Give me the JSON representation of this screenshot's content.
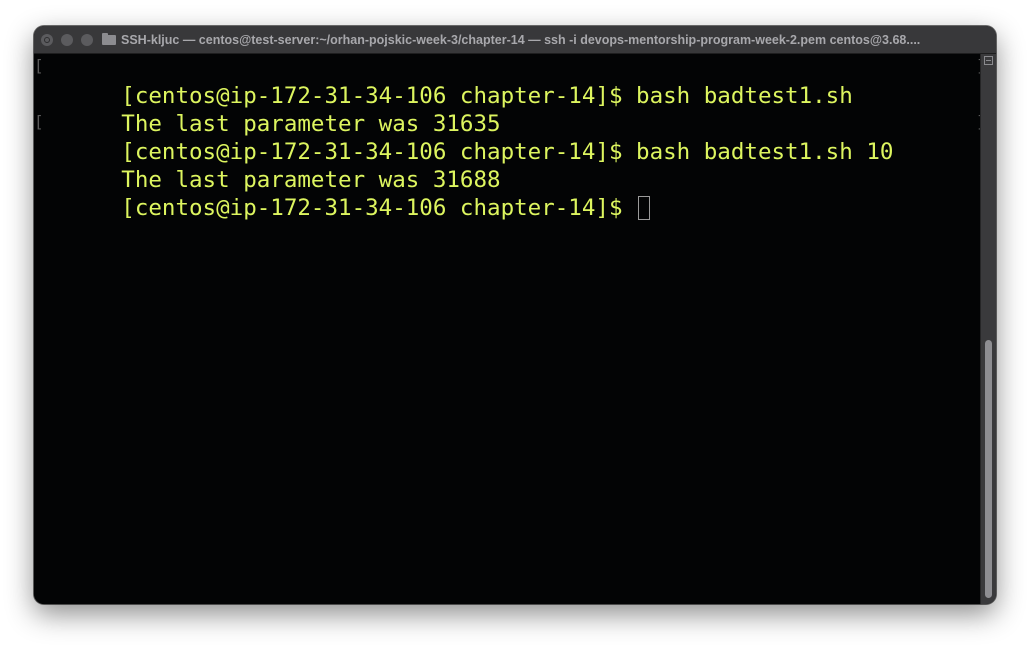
{
  "window": {
    "title": "SSH-kljuc — centos@test-server:~/orhan-pojskic-week-3/chapter-14 — ssh -i devops-mentorship-program-week-2.pem centos@3.68...."
  },
  "terminal": {
    "lines": [
      {
        "text": "[centos@ip-172-31-34-106 chapter-14]$ bash badtest1.sh",
        "marked": true
      },
      {
        "text": "The last parameter was 31635",
        "marked": false
      },
      {
        "text": "[centos@ip-172-31-34-106 chapter-14]$ bash badtest1.sh 10",
        "marked": true
      },
      {
        "text": "The last parameter was 31688",
        "marked": false
      }
    ],
    "prompt": "[centos@ip-172-31-34-106 chapter-14]$ ",
    "text_color": "#ddf55f",
    "background_color": "#030405"
  },
  "icons": {
    "folder": "folder-icon",
    "cursor": "block-cursor-icon"
  }
}
